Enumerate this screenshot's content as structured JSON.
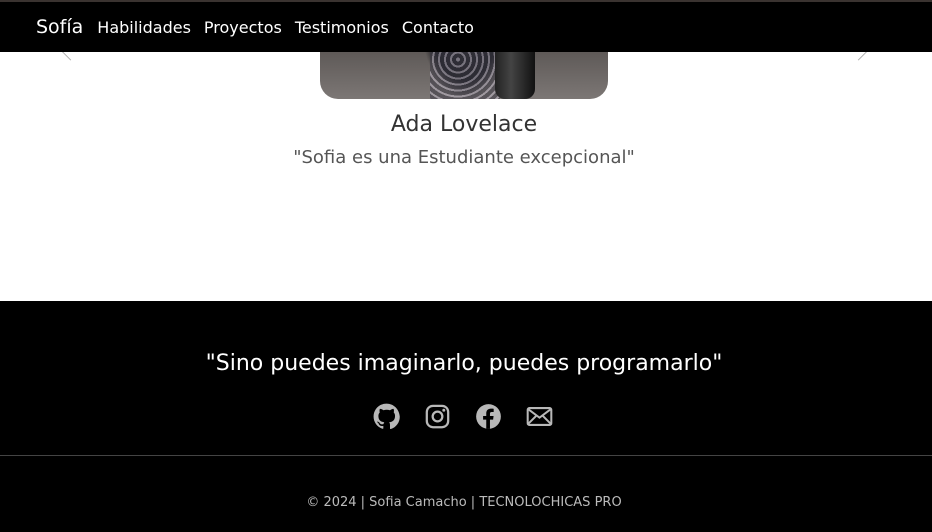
{
  "nav": {
    "brand": "Sofía",
    "links": [
      "Habilidades",
      "Proyectos",
      "Testimonios",
      "Contacto"
    ]
  },
  "testimonial": {
    "name": "Ada Lovelace",
    "quote": "\"Sofia es una Estudiante excepcional\""
  },
  "footer": {
    "motto": "\"Sino puedes imaginarlo, puedes programarlo\"",
    "social_icons": [
      "github-icon",
      "instagram-icon",
      "facebook-icon",
      "mail-icon"
    ],
    "copyright": "© 2024 | Sofia Camacho | TECNOLOCHICAS PRO"
  },
  "colors": {
    "navbar_bg": "#000000",
    "footer_bg": "#000000",
    "icon_color": "#b8b8b8"
  }
}
